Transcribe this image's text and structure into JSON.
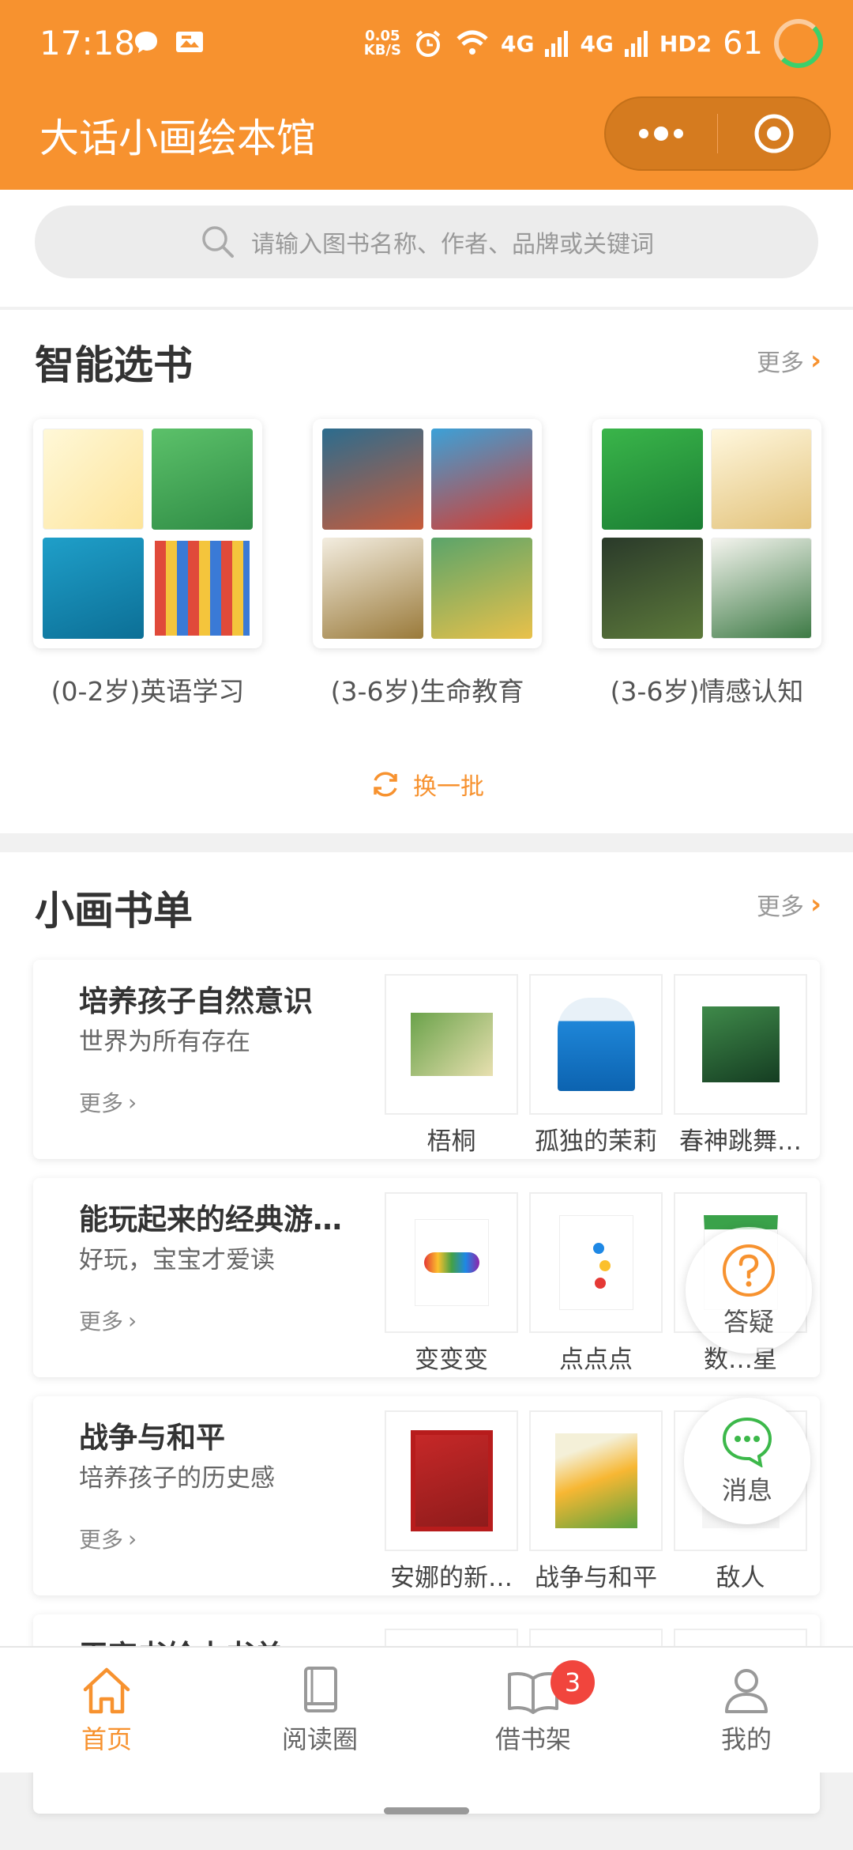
{
  "status": {
    "time": "17:18",
    "speed_top": "0.05",
    "speed_bottom": "KB/S",
    "net1": "4G",
    "net2": "4G",
    "hd": "HD2",
    "battery": "61"
  },
  "header": {
    "title": "大话小画绘本馆"
  },
  "search": {
    "placeholder": "请输入图书名称、作者、品牌或关键词"
  },
  "smart_picks": {
    "title": "智能选书",
    "more": "更多",
    "refresh": "换一批",
    "items": [
      {
        "label": "(0-2岁)英语学习"
      },
      {
        "label": "(3-6岁)生命教育"
      },
      {
        "label": "(3-6岁)情感认知"
      }
    ]
  },
  "book_lists": {
    "title": "小画书单",
    "more": "更多",
    "cards": [
      {
        "title": "培养孩子自然意识",
        "subtitle": "世界为所有存在",
        "more": "更多",
        "books": [
          "梧桐",
          "孤独的茉莉",
          "春神跳舞…"
        ]
      },
      {
        "title": "能玩起来的经典游…",
        "subtitle": "好玩，宝宝才爱读",
        "more": "更多",
        "books": [
          "变变变",
          "点点点",
          "数…星"
        ]
      },
      {
        "title": "战争与和平",
        "subtitle": "培养孩子的历史感",
        "more": "更多",
        "books": [
          "安娜的新…",
          "战争与和平",
          "敌人"
        ]
      },
      {
        "title": "王宇书绘本书单",
        "subtitle": "",
        "more": "",
        "books": [
          "",
          "",
          ""
        ]
      }
    ]
  },
  "floating": {
    "qa": "答疑",
    "msg": "消息"
  },
  "tabs": [
    {
      "label": "首页",
      "icon": "home-icon"
    },
    {
      "label": "阅读圈",
      "icon": "book-icon"
    },
    {
      "label": "借书架",
      "icon": "open-book-icon",
      "badge": "3"
    },
    {
      "label": "我的",
      "icon": "user-icon"
    }
  ],
  "colors": {
    "brand": "#f7922f",
    "badge": "#f1453d"
  }
}
